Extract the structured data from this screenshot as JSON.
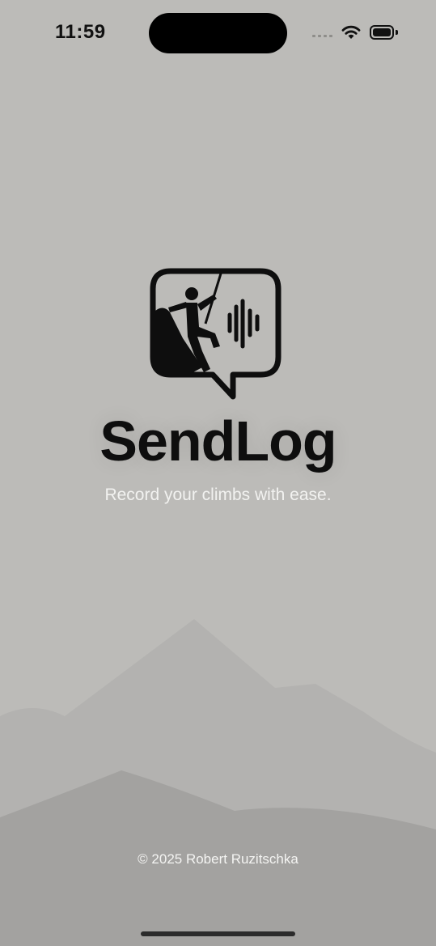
{
  "status_bar": {
    "time": "11:59",
    "icons": [
      "cellular-signal-icon",
      "wifi-icon",
      "battery-icon"
    ]
  },
  "splash": {
    "logo_icon": "climber-speech-bubble-logo-icon",
    "app_name": "SendLog",
    "tagline": "Record your climbs with ease."
  },
  "footer": {
    "copyright": "© 2025 Robert Ruzitschka"
  },
  "colors": {
    "background": "#bcbbb8",
    "text_dark": "#0e0e0e",
    "text_light": "#f2f2f0",
    "mountain_far": "#b3b2b0",
    "mountain_near": "#a3a2a0"
  }
}
